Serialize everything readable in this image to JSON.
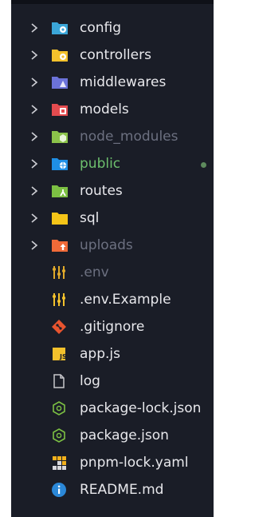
{
  "explorer": {
    "items": [
      {
        "type": "folder",
        "name": "config",
        "icon": "config-folder-icon",
        "color": "#3ba6d8",
        "state": "normal"
      },
      {
        "type": "folder",
        "name": "controllers",
        "icon": "controllers-folder-icon",
        "color": "#f3c12c",
        "state": "normal"
      },
      {
        "type": "folder",
        "name": "middlewares",
        "icon": "middlewares-folder-icon",
        "color": "#6c73d9",
        "state": "normal"
      },
      {
        "type": "folder",
        "name": "models",
        "icon": "models-folder-icon",
        "color": "#e44b4f",
        "state": "normal"
      },
      {
        "type": "folder",
        "name": "node_modules",
        "icon": "node-modules-folder-icon",
        "color": "#8bc34a",
        "state": "dim"
      },
      {
        "type": "folder",
        "name": "public",
        "icon": "public-folder-icon",
        "color": "#1f8fe5",
        "state": "modified"
      },
      {
        "type": "folder",
        "name": "routes",
        "icon": "routes-folder-icon",
        "color": "#7cc043",
        "state": "normal"
      },
      {
        "type": "folder",
        "name": "sql",
        "icon": "sql-folder-icon",
        "color": "#f5c518",
        "state": "normal"
      },
      {
        "type": "folder",
        "name": "uploads",
        "icon": "uploads-folder-icon",
        "color": "#f06a38",
        "state": "dim"
      },
      {
        "type": "file",
        "name": ".env",
        "icon": "env-file-icon",
        "color": "#f3c12c",
        "state": "dim"
      },
      {
        "type": "file",
        "name": ".env.Example",
        "icon": "env-file-icon",
        "color": "#f3c12c",
        "state": "normal"
      },
      {
        "type": "file",
        "name": ".gitignore",
        "icon": "git-icon",
        "color": "#e8542f",
        "state": "normal"
      },
      {
        "type": "file",
        "name": "app.js",
        "icon": "javascript-icon",
        "color": "#f3c12c",
        "state": "normal"
      },
      {
        "type": "file",
        "name": "log",
        "icon": "file-icon",
        "color": "#c8c8cc",
        "state": "normal"
      },
      {
        "type": "file",
        "name": "package-lock.json",
        "icon": "npm-package-icon",
        "color": "#7cc043",
        "state": "normal"
      },
      {
        "type": "file",
        "name": "package.json",
        "icon": "npm-package-icon",
        "color": "#7cc043",
        "state": "normal"
      },
      {
        "type": "file",
        "name": "pnpm-lock.yaml",
        "icon": "pnpm-icon",
        "color": "#f3b11c",
        "state": "normal"
      },
      {
        "type": "file",
        "name": "README.md",
        "icon": "info-icon",
        "color": "#2b88d8",
        "state": "normal"
      }
    ]
  }
}
